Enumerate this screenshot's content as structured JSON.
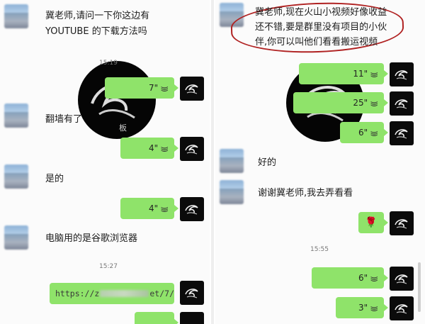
{
  "left": {
    "messages": [
      {
        "line1": "冀老师,请问一下你这边有",
        "line2": "YOUTUBE 的下载方法吗"
      },
      {
        "text": "翻墙有了"
      },
      {
        "text": "是的"
      },
      {
        "text": "电脑用的是谷歌浏览器"
      }
    ],
    "times": [
      "15:19",
      "15:27"
    ],
    "voice_bubbles": [
      "7\"",
      "4\"",
      "4\""
    ],
    "link": {
      "start": "https://z",
      "end": "et/7/"
    }
  },
  "right": {
    "highlight": {
      "line1": "冀老师,现在火山小视频好像收益",
      "line2": "还不错,要是群里没有项目的小伙",
      "line3": "伴,你可以叫他们看看搬运视频"
    },
    "voice_bubbles_top": [
      "11\"",
      "25\"",
      "6\""
    ],
    "messages": [
      {
        "text": "好的"
      },
      {
        "text": "谢谢冀老师,我去弄看看"
      }
    ],
    "rose": "🌹",
    "time": "15:55",
    "voice_bubbles_bottom": [
      "6\"",
      "3\""
    ]
  },
  "icons": {
    "voice": "voice-wave-icon",
    "user_avatar": "swirl-logo-avatar",
    "rose": "rose-emoji"
  },
  "colors": {
    "bubble": "#8fe36a",
    "annotation": "#b02222",
    "avatar": "#0b0b0b"
  }
}
